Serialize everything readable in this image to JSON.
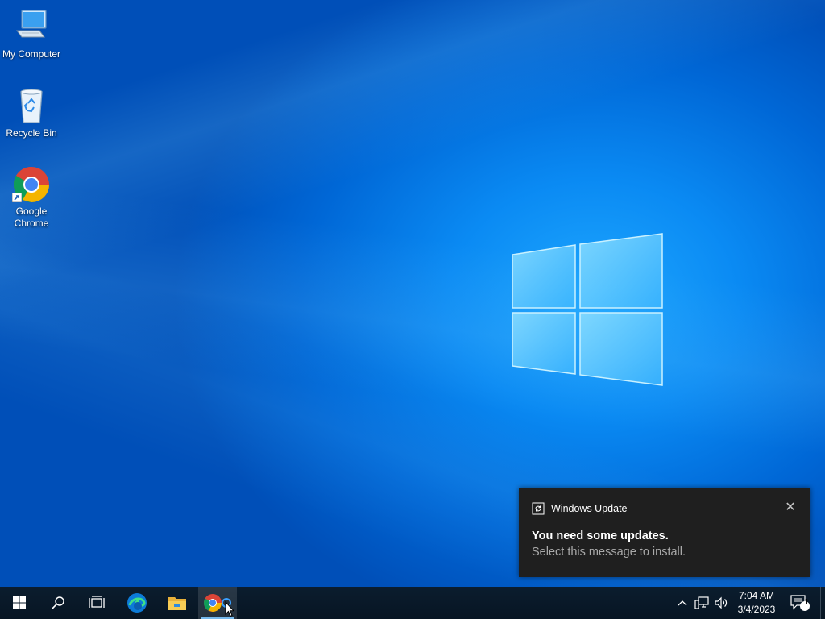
{
  "desktop": {
    "icons": [
      {
        "label": "My Computer",
        "icon": "computer-icon"
      },
      {
        "label": "Recycle Bin",
        "icon": "recycle-bin-icon"
      },
      {
        "label": "Google",
        "label2": "Chrome",
        "icon": "chrome-icon"
      }
    ]
  },
  "toast": {
    "app": "Windows Update",
    "title": "You need some updates.",
    "message": "Select this message to install."
  },
  "taskbar": {
    "pinned": [
      "start-icon",
      "search-icon",
      "task-view-icon",
      "edge-icon",
      "file-explorer-icon",
      "chrome-icon"
    ],
    "clock": {
      "time": "7:04 AM",
      "date": "3/4/2023"
    },
    "notifications_count": "1"
  },
  "colors": {
    "desktop_blue": "#0a8af3",
    "taskbar": "#071523",
    "toast_bg": "#1f1f1f",
    "accent": "#76b9ed"
  }
}
